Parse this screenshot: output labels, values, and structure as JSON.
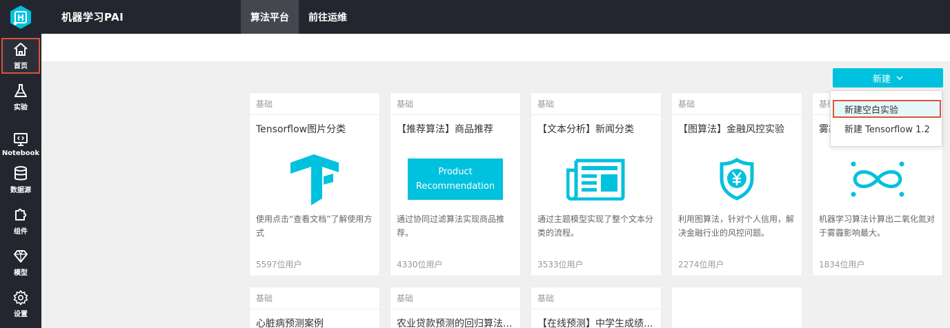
{
  "header": {
    "app_title": "机器学习PAI",
    "nav": [
      {
        "label": "算法平台",
        "active": true
      },
      {
        "label": "前往运维",
        "active": false
      }
    ]
  },
  "sidebar": {
    "items": [
      {
        "label": "首页",
        "icon": "home-icon",
        "active": true
      },
      {
        "label": "实验",
        "icon": "flask-icon",
        "active": false
      },
      {
        "label": "Notebook",
        "icon": "notebook-icon",
        "active": false
      },
      {
        "label": "数据源",
        "icon": "database-icon",
        "active": false
      },
      {
        "label": "组件",
        "icon": "puzzle-icon",
        "active": false
      },
      {
        "label": "模型",
        "icon": "diamond-icon",
        "active": false
      },
      {
        "label": "设置",
        "icon": "gear-icon",
        "active": false
      }
    ]
  },
  "toolbar": {
    "new_label": "新建"
  },
  "dropdown": {
    "items": [
      {
        "label": "新建空白实验",
        "highlighted": true
      },
      {
        "label": "新建 Tensorflow 1.2",
        "highlighted": false
      }
    ]
  },
  "cards": [
    {
      "tag": "基础",
      "title": "Tensorflow图片分类",
      "image": "tensorflow-logo",
      "desc": "使用点击“查看文档”了解使用方式",
      "users": "5597位用户"
    },
    {
      "tag": "基础",
      "title": "【推荐算法】商品推荐",
      "image": "product-recommendation",
      "image_text": [
        "Product",
        "Recommendation"
      ],
      "desc": "通过协同过滤算法实现商品推荐。",
      "users": "4330位用户"
    },
    {
      "tag": "基础",
      "title": "【文本分析】新闻分类",
      "image": "newspaper-icon",
      "desc": "通过主题模型实现了整个文本分类的流程。",
      "users": "3533位用户"
    },
    {
      "tag": "基础",
      "title": "【图算法】金融风控实验",
      "image": "yen-shield-icon",
      "desc": "利用图算法，针对个人信用，解决金融行业的风控问题。",
      "users": "2274位用户"
    },
    {
      "tag": "基础",
      "title": "雾霾",
      "image": "infinity-icon",
      "desc": "机器学习算法计算出二氧化氮对于雾霾影响最大。",
      "users": "1834位用户"
    },
    {
      "tag": "基础",
      "title": "心脏病预测案例"
    },
    {
      "tag": "基础",
      "title": "农业贷款预测的回归算法..."
    },
    {
      "tag": "基础",
      "title": "【在线预测】中学生成绩..."
    }
  ],
  "colors": {
    "accent": "#00c1de",
    "topbar": "#23262e",
    "highlight_border": "#d9533b"
  }
}
